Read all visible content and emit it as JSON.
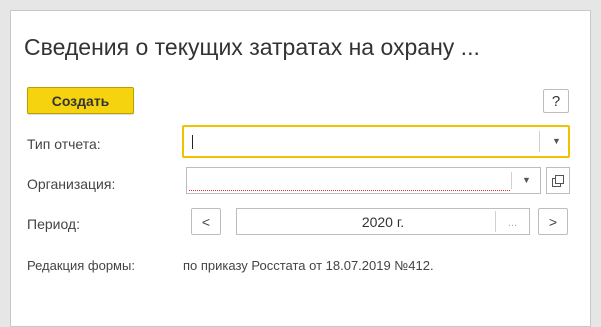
{
  "form": {
    "title": "Сведения о текущих затратах на охрану ...",
    "create_label": "Создать",
    "help_label": "?"
  },
  "fields": {
    "report_type": {
      "label": "Тип отчета:",
      "value": ""
    },
    "organization": {
      "label": "Организация:",
      "value": ""
    },
    "period": {
      "label": "Период:",
      "value": "2020 г.",
      "prev": "<",
      "next": ">",
      "choose": "..."
    },
    "edition": {
      "label": "Редакция формы:",
      "value": "по приказу Росстата от 18.07.2019 №412."
    }
  },
  "icons": {
    "dropdown": "chevron-down-icon",
    "open": "open-icon"
  },
  "colors": {
    "create_button": "#f5d40f",
    "active_field_border": "#f2c200",
    "invalid_underline": "#e03030"
  }
}
